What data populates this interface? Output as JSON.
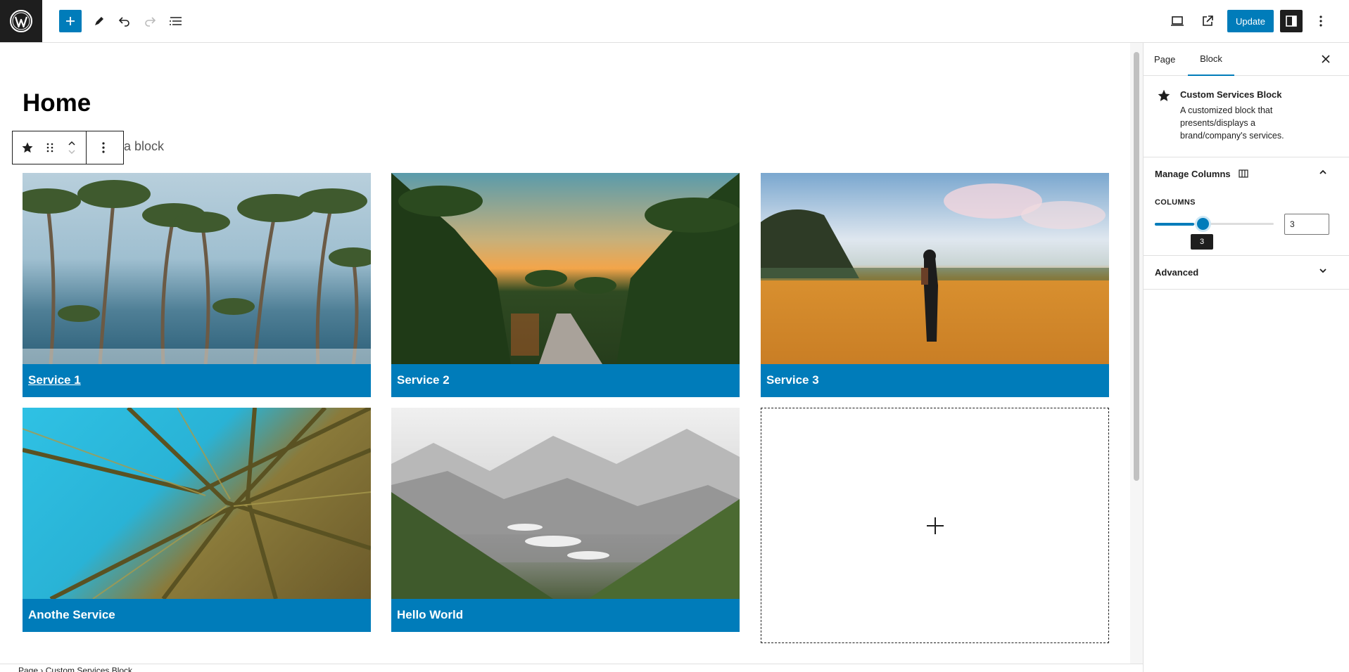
{
  "toolbar": {
    "update_label": "Update"
  },
  "editor": {
    "page_title": "Home",
    "partial_block_text": "a block",
    "cards": [
      {
        "caption": "Service 1"
      },
      {
        "caption": "Service 2"
      },
      {
        "caption": "Service 3"
      },
      {
        "caption": "Anothe Service"
      },
      {
        "caption": "Hello World"
      }
    ],
    "footer_breadcrumb": "Page  ›  Custom Services Block"
  },
  "sidebar": {
    "tabs": [
      {
        "label": "Page"
      },
      {
        "label": "Block"
      }
    ],
    "block_card": {
      "title": "Custom Services Block",
      "description": "A customized block that presents/displays a brand/company's services."
    },
    "manage_columns": {
      "title": "Manage Columns",
      "columns_label": "COLUMNS",
      "value": "3",
      "tooltip": "3",
      "range_fraction": 0.33
    },
    "advanced": {
      "title": "Advanced"
    }
  },
  "colors": {
    "accent": "#007cba",
    "dark": "#1e1e1e"
  }
}
